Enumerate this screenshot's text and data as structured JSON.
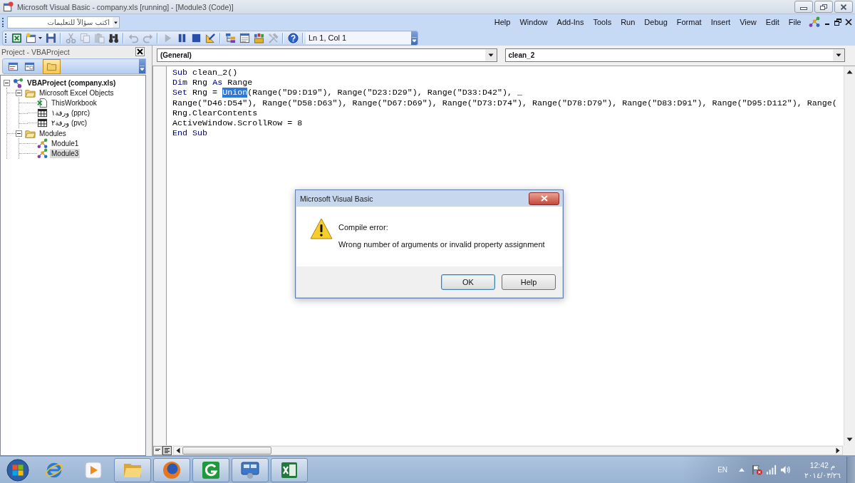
{
  "window": {
    "title": "Microsoft Visual Basic - company.xls [running] - [Module3 (Code)]"
  },
  "menu_bar": {
    "help_box": {
      "placeholder": "اكتب سؤالاً للتعليمات"
    },
    "items": [
      {
        "label": "Help"
      },
      {
        "label": "Window"
      },
      {
        "label": "Add-Ins"
      },
      {
        "label": "Tools"
      },
      {
        "label": "Run"
      },
      {
        "label": "Debug"
      },
      {
        "label": "Format"
      },
      {
        "label": "Insert"
      },
      {
        "label": "View"
      },
      {
        "label": "Edit"
      },
      {
        "label": "File"
      }
    ]
  },
  "toolbar": {
    "groups": [
      [
        {
          "kind": "excel",
          "disabled": false
        },
        {
          "kind": "insert-module",
          "disabled": false
        },
        {
          "kind": "save",
          "disabled": false
        }
      ],
      [
        {
          "kind": "cut",
          "disabled": true
        },
        {
          "kind": "copy",
          "disabled": true
        },
        {
          "kind": "paste",
          "disabled": true
        },
        {
          "kind": "find",
          "disabled": false
        }
      ],
      [
        {
          "kind": "undo",
          "disabled": true
        },
        {
          "kind": "redo",
          "disabled": true
        }
      ],
      [
        {
          "kind": "run",
          "disabled": true
        },
        {
          "kind": "break",
          "disabled": false
        },
        {
          "kind": "reset",
          "disabled": false
        },
        {
          "kind": "design",
          "disabled": false
        }
      ],
      [
        {
          "kind": "project-explorer",
          "disabled": false
        },
        {
          "kind": "properties",
          "disabled": false
        },
        {
          "kind": "object-browser",
          "disabled": false
        },
        {
          "kind": "toolbox",
          "disabled": true
        }
      ],
      [
        {
          "kind": "help",
          "disabled": false
        }
      ]
    ],
    "position": "Ln 1, Col 1"
  },
  "project_panel": {
    "title": "Project - VBAProject",
    "toolbar": [
      {
        "kind": "view-code",
        "on": false
      },
      {
        "kind": "view-object",
        "on": false
      },
      {
        "kind": "toggle-folders",
        "on": true
      }
    ],
    "tree": [
      {
        "label": "VBAProject (company.xls)",
        "kind": "project",
        "expanded": true,
        "selected": false,
        "children": [
          {
            "label": "Microsoft Excel Objects",
            "kind": "folder",
            "expanded": true,
            "selected": false,
            "children": [
              {
                "label": "ThisWorkbook",
                "kind": "workbook",
                "selected": false
              },
              {
                "label": "ورقة١ (pprc)",
                "kind": "sheet",
                "selected": false
              },
              {
                "label": "ورقة٢ (pvc)",
                "kind": "sheet",
                "selected": false
              }
            ]
          },
          {
            "label": "Modules",
            "kind": "folder",
            "expanded": true,
            "selected": false,
            "children": [
              {
                "label": "Module1",
                "kind": "module",
                "selected": false
              },
              {
                "label": "Module3",
                "kind": "module",
                "selected": true
              }
            ]
          }
        ]
      }
    ]
  },
  "code_window": {
    "object_box": {
      "value": "(General)"
    },
    "procedure_box": {
      "value": "clean_2"
    },
    "lines": [
      {
        "segments": [
          {
            "kind": "keyword",
            "text": "Sub"
          },
          {
            "kind": "plain",
            "text": " clean_2()"
          }
        ]
      },
      {
        "segments": [
          {
            "kind": "keyword",
            "text": "Dim"
          },
          {
            "kind": "plain",
            "text": " Rng "
          },
          {
            "kind": "keyword",
            "text": "As"
          },
          {
            "kind": "plain",
            "text": " Range"
          }
        ]
      },
      {
        "segments": [
          {
            "kind": "keyword",
            "text": "Set"
          },
          {
            "kind": "plain",
            "text": " Rng = "
          },
          {
            "kind": "selection",
            "text": "Union"
          },
          {
            "kind": "plain",
            "text": "(Range(\"D9:D19\"), Range(\"D23:D29\"), Range(\"D33:D42\"), _"
          }
        ]
      },
      {
        "segments": [
          {
            "kind": "plain",
            "text": "Range(\"D46:D54\"), Range(\"D58:D63\"), Range(\"D67:D69\"), Range(\"D73:D74\"), Range(\"D78:D79\"), Range(\"D83:D91\"), Range(\"D95:D112\"), Range("
          }
        ]
      },
      {
        "segments": [
          {
            "kind": "plain",
            "text": "Rng.ClearContents"
          }
        ]
      },
      {
        "segments": [
          {
            "kind": "plain",
            "text": "ActiveWindow.ScrollRow = 8"
          }
        ]
      },
      {
        "segments": [
          {
            "kind": "keyword",
            "text": "End Sub"
          }
        ]
      }
    ],
    "view_buttons": [
      {
        "kind": "procedure",
        "on": false
      },
      {
        "kind": "module",
        "on": true
      }
    ]
  },
  "dialog": {
    "title": "Microsoft Visual Basic",
    "heading": "Compile error:",
    "message": "Wrong number of arguments or invalid property assignment",
    "buttons": [
      {
        "label": "OK",
        "default": true
      },
      {
        "label": "Help",
        "default": false
      }
    ]
  },
  "taskbar": {
    "apps": [
      {
        "kind": "ie",
        "running": false
      },
      {
        "kind": "media-player",
        "running": false
      },
      {
        "kind": "explorer",
        "running": true
      },
      {
        "kind": "firefox",
        "running": true
      },
      {
        "kind": "g-app",
        "running": true
      },
      {
        "kind": "control-panel",
        "running": true
      },
      {
        "kind": "excel",
        "running": true
      }
    ],
    "tray": {
      "language": "EN",
      "time": "12:42 م",
      "date": "٢٠١٤/٠٣/٢٦"
    }
  }
}
